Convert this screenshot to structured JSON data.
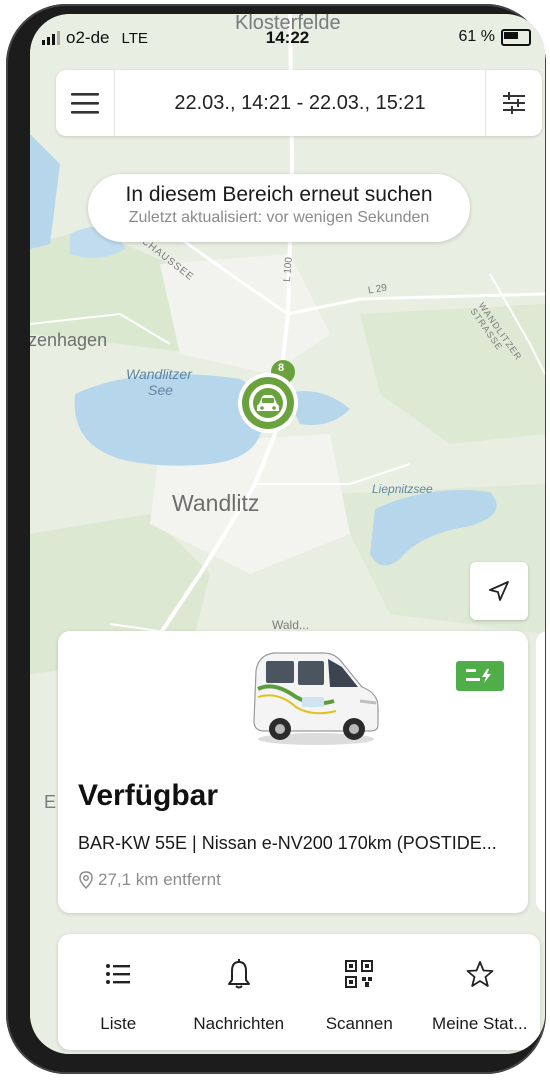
{
  "status_bar": {
    "carrier": "o2-de",
    "network": "LTE",
    "time": "14:22",
    "battery": "61 %"
  },
  "top_bar": {
    "date_range": "22.03., 14:21 - 22.03., 15:21",
    "menu_icon": "hamburger-menu-icon",
    "filter_icon": "sliders-filter-icon"
  },
  "search_area": {
    "title": "In diesem Bereich erneut suchen",
    "subtitle": "Zuletzt aktualisiert: vor wenigen Sekunden"
  },
  "map": {
    "labels": {
      "town_top": "Klosterfelde",
      "town_left": "zenhagen",
      "lake_1": "Wandlitzer",
      "lake_2": "See",
      "town_main": "Wandlitz",
      "lake_right": "Liepnitzsee",
      "road_l100": "L 100",
      "road_l29": "L 29",
      "road_chaussee": "CHAUSSEE",
      "road_strasse": "WANDLITZER STRASSE",
      "town_bottom": "Wald...",
      "edge_letter": "E"
    },
    "marker_icon": "car-icon",
    "cluster_badge": "8",
    "locate_icon": "navigation-arrow-icon"
  },
  "vehicle_card": {
    "status": "Verfügbar",
    "description": "BAR-KW 55E | Nissan e-NV200 170km (POSTIDE...",
    "distance": "27,1 km entfernt",
    "badge_icon": "electric-charge-icon",
    "image": "white-van-image"
  },
  "bottom_nav": {
    "items": [
      {
        "label": "Liste",
        "icon": "list-icon"
      },
      {
        "label": "Nachrichten",
        "icon": "bell-icon"
      },
      {
        "label": "Scannen",
        "icon": "qr-code-icon"
      },
      {
        "label": "Meine Stat...",
        "icon": "star-icon"
      }
    ]
  },
  "colors": {
    "accent_green": "#6aa33e",
    "badge_green": "#4fae48",
    "water": "#b6d6ec",
    "land": "#e9eee4"
  }
}
